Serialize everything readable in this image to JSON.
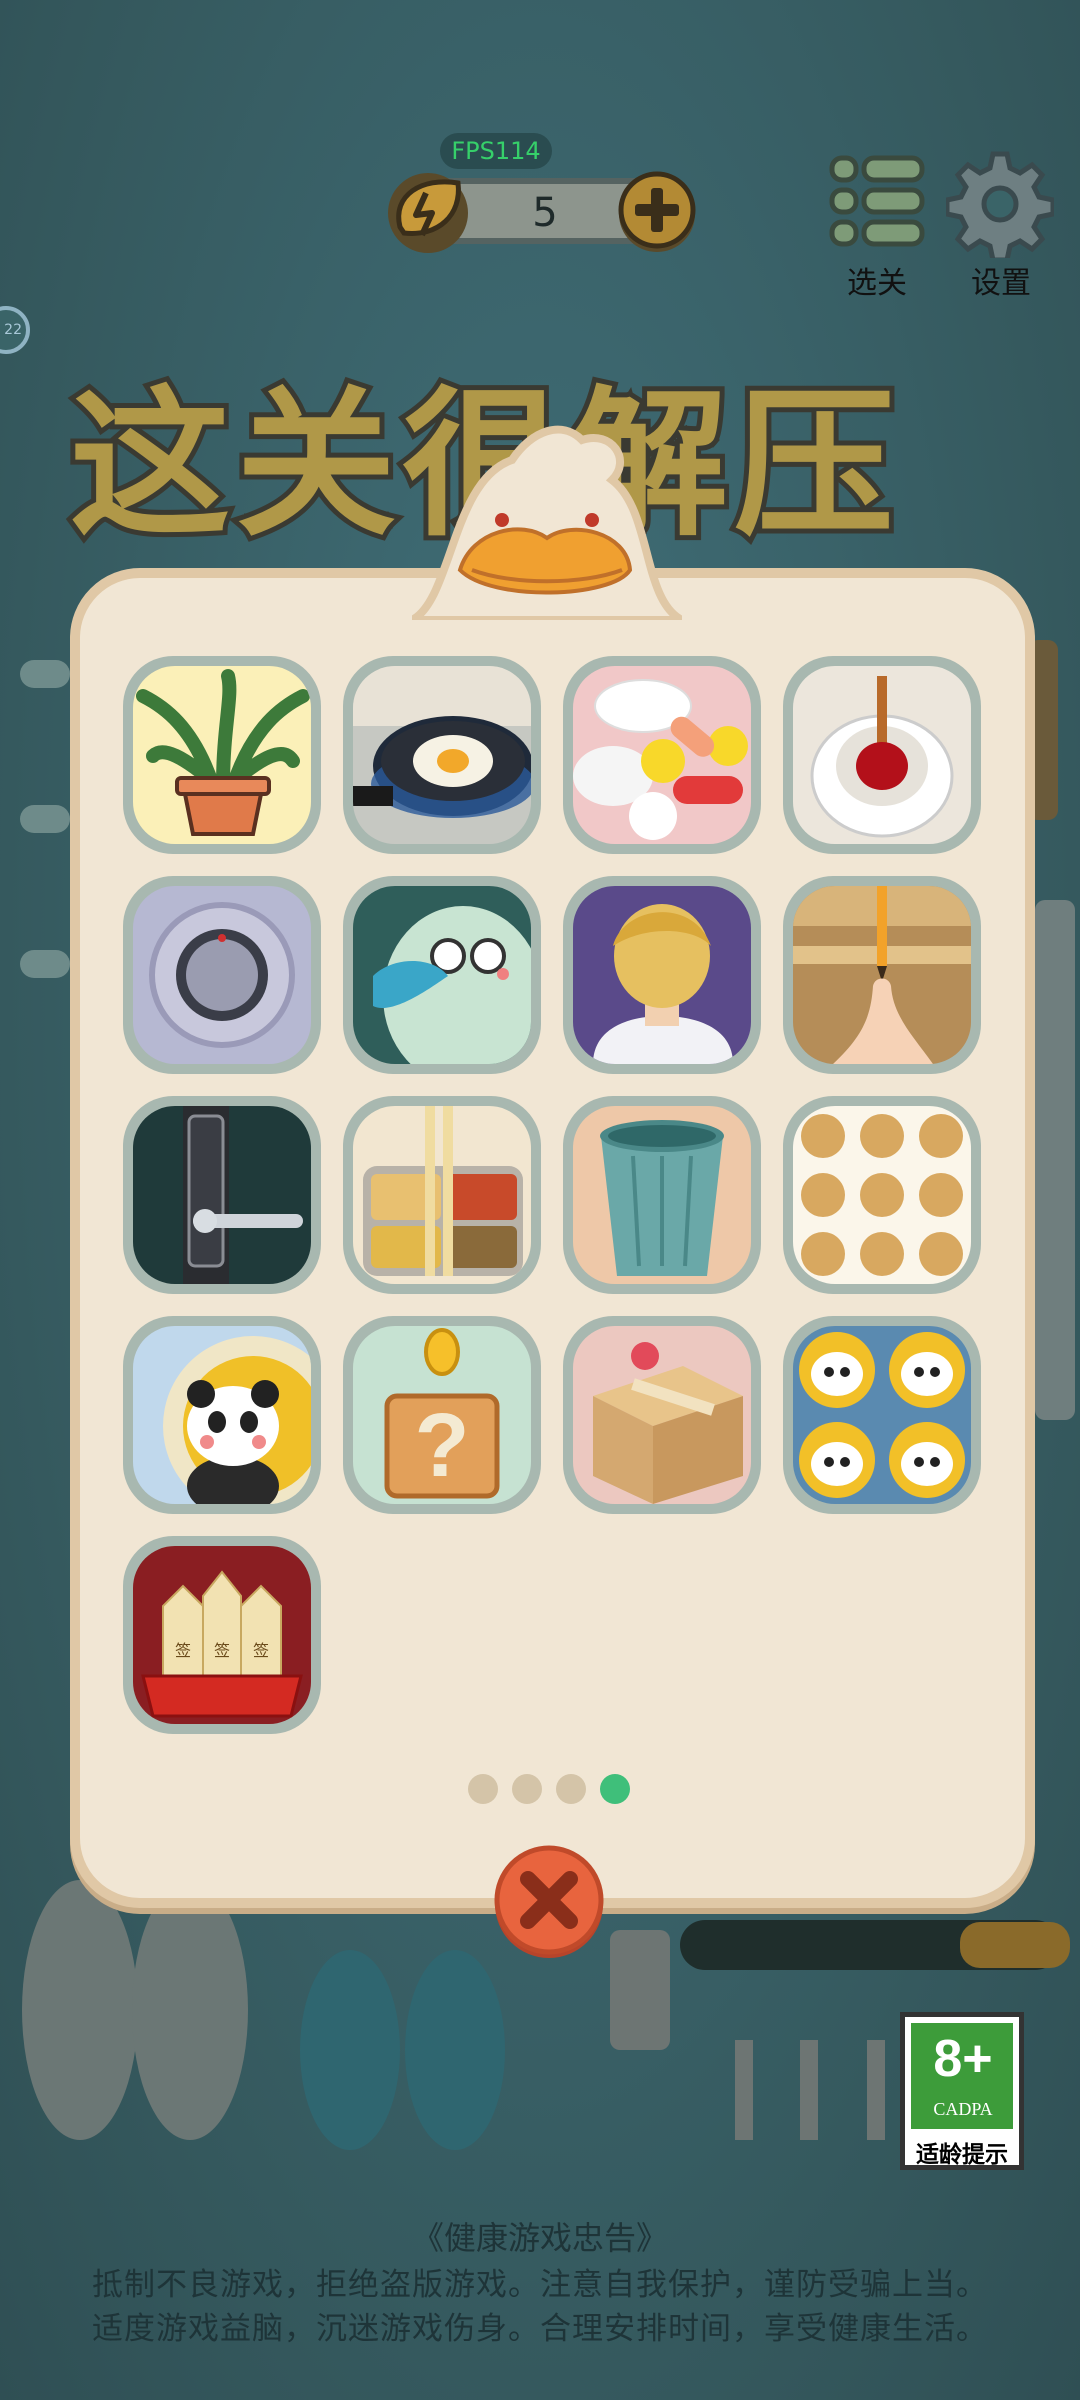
{
  "hud": {
    "fps": "FPS114",
    "energy": "5",
    "menu_label": "选关",
    "settings_label": "设置",
    "side_timer": "22"
  },
  "title": "这关很解压",
  "levels": [
    {
      "icon": "potted-plant"
    },
    {
      "icon": "frying-egg"
    },
    {
      "icon": "pills"
    },
    {
      "icon": "toilet-plunger"
    },
    {
      "icon": "safe-dial"
    },
    {
      "icon": "bird-with-glasses"
    },
    {
      "icon": "blonde-boy"
    },
    {
      "icon": "pencil-on-finger"
    },
    {
      "icon": "door-handle"
    },
    {
      "icon": "lunch-box"
    },
    {
      "icon": "trash-can"
    },
    {
      "icon": "bear-pattern"
    },
    {
      "icon": "panda-plate"
    },
    {
      "icon": "question-block"
    },
    {
      "icon": "cardboard-box"
    },
    {
      "icon": "four-pandas"
    },
    {
      "icon": "fortune-sticks",
      "stick_text": "签"
    }
  ],
  "pagination": {
    "total": 4,
    "current": 4
  },
  "age_rating": {
    "number": "8+",
    "org": "CADPA",
    "tip": "适龄提示"
  },
  "health_advice": {
    "title": "《健康游戏忠告》",
    "line1": "抵制不良游戏，拒绝盗版游戏。注意自我保护，谨防受骗上当。",
    "line2": "适度游戏益脑，沉迷游戏伤身。合理安排时间，享受健康生活。"
  },
  "colors": {
    "panel": "#f1e6d4",
    "active_dot": "#3fbf7a",
    "close_button": "#e8643e",
    "background": "#3a6468"
  }
}
